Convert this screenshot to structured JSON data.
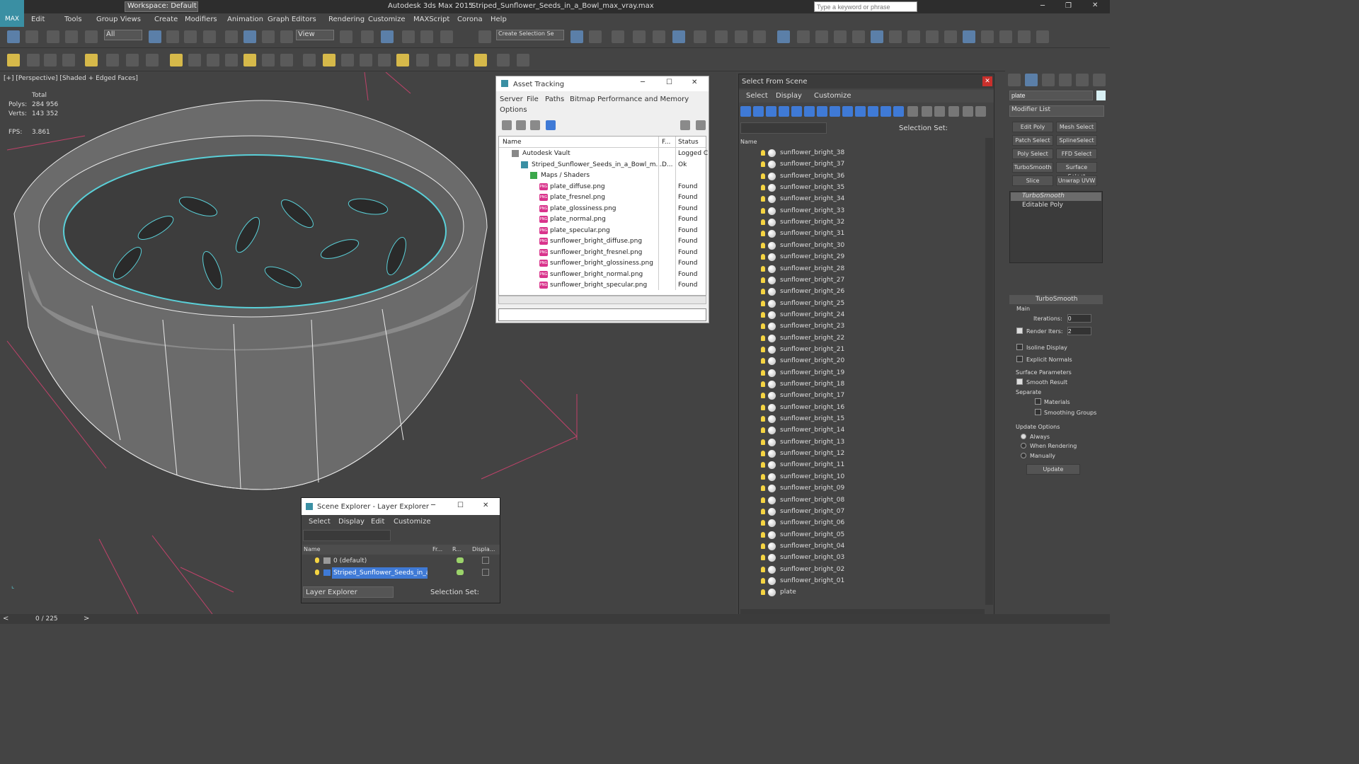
{
  "app": {
    "title": "Autodesk 3ds Max  2015",
    "file": "Striped_Sunflower_Seeds_in_a_Bowl_max_vray.max",
    "workspace": "Workspace: Default",
    "search_placeholder": "Type a keyword or phrase"
  },
  "menu": [
    "Edit",
    "Tools",
    "Group",
    "Views",
    "Create",
    "Modifiers",
    "Animation",
    "Graph Editors",
    "Rendering",
    "Customize",
    "MAXScript",
    "Corona",
    "Help"
  ],
  "toolbar": {
    "filter_all": "All",
    "view_select": "View",
    "create_selection": "Create Selection Se"
  },
  "viewport": {
    "label": "[+] [Perspective] [Shaded + Edged Faces]",
    "stats": {
      "total_label": "Total",
      "polys_label": "Polys:",
      "polys": "284 956",
      "verts_label": "Verts:",
      "verts": "143 352",
      "fps_label": "FPS:",
      "fps": "3.861"
    }
  },
  "asset_tracking": {
    "title": "Asset Tracking",
    "menu": [
      "Server",
      "File",
      "Paths",
      "Bitmap Performance and Memory"
    ],
    "options": "Options",
    "col_name": "Name",
    "col_f": "F...",
    "col_status": "Status",
    "rows": [
      {
        "name": "Autodesk Vault",
        "f": "",
        "status": "Logged C",
        "level": 0,
        "kind": "vault"
      },
      {
        "name": "Striped_Sunflower_Seeds_in_a_Bowl_m...",
        "f": "D...",
        "status": "Ok",
        "level": 1,
        "kind": "max"
      },
      {
        "name": "Maps / Shaders",
        "f": "",
        "status": "",
        "level": 2,
        "kind": "folder"
      },
      {
        "name": "plate_diffuse.png",
        "f": "",
        "status": "Found",
        "level": 3,
        "kind": "png"
      },
      {
        "name": "plate_fresnel.png",
        "f": "",
        "status": "Found",
        "level": 3,
        "kind": "png"
      },
      {
        "name": "plate_glossiness.png",
        "f": "",
        "status": "Found",
        "level": 3,
        "kind": "png"
      },
      {
        "name": "plate_normal.png",
        "f": "",
        "status": "Found",
        "level": 3,
        "kind": "png"
      },
      {
        "name": "plate_specular.png",
        "f": "",
        "status": "Found",
        "level": 3,
        "kind": "png"
      },
      {
        "name": "sunflower_bright_diffuse.png",
        "f": "",
        "status": "Found",
        "level": 3,
        "kind": "png"
      },
      {
        "name": "sunflower_bright_fresnel.png",
        "f": "",
        "status": "Found",
        "level": 3,
        "kind": "png"
      },
      {
        "name": "sunflower_bright_glossiness.png",
        "f": "",
        "status": "Found",
        "level": 3,
        "kind": "png"
      },
      {
        "name": "sunflower_bright_normal.png",
        "f": "",
        "status": "Found",
        "level": 3,
        "kind": "png"
      },
      {
        "name": "sunflower_bright_specular.png",
        "f": "",
        "status": "Found",
        "level": 3,
        "kind": "png"
      }
    ]
  },
  "select_from_scene": {
    "title": "Select From Scene",
    "menu": [
      "Select",
      "Display",
      "Customize"
    ],
    "selection_set": "Selection Set:",
    "col_name": "Name",
    "items": [
      "sunflower_bright_38",
      "sunflower_bright_37",
      "sunflower_bright_36",
      "sunflower_bright_35",
      "sunflower_bright_34",
      "sunflower_bright_33",
      "sunflower_bright_32",
      "sunflower_bright_31",
      "sunflower_bright_30",
      "sunflower_bright_29",
      "sunflower_bright_28",
      "sunflower_bright_27",
      "sunflower_bright_26",
      "sunflower_bright_25",
      "sunflower_bright_24",
      "sunflower_bright_23",
      "sunflower_bright_22",
      "sunflower_bright_21",
      "sunflower_bright_20",
      "sunflower_bright_19",
      "sunflower_bright_18",
      "sunflower_bright_17",
      "sunflower_bright_16",
      "sunflower_bright_15",
      "sunflower_bright_14",
      "sunflower_bright_13",
      "sunflower_bright_12",
      "sunflower_bright_11",
      "sunflower_bright_10",
      "sunflower_bright_09",
      "sunflower_bright_08",
      "sunflower_bright_07",
      "sunflower_bright_06",
      "sunflower_bright_05",
      "sunflower_bright_04",
      "sunflower_bright_03",
      "sunflower_bright_02",
      "sunflower_bright_01",
      "plate"
    ]
  },
  "scene_explorer": {
    "title": "Scene Explorer - Layer Explorer",
    "menu": [
      "Select",
      "Display",
      "Edit",
      "Customize"
    ],
    "col_name": "Name",
    "col_fr": "Fr...",
    "col_r": "R...",
    "col_disp": "Displa...",
    "rows": [
      {
        "name": "0 (default)",
        "selected": false
      },
      {
        "name": "Striped_Sunflower_Seeds_in_a...",
        "selected": true
      }
    ],
    "explorer_select": "Layer Explorer",
    "selection_set": "Selection Set:"
  },
  "command_panel": {
    "object_name": "plate",
    "modifier_list": "Modifier List",
    "buttons": [
      "Edit Poly",
      "Mesh Select",
      "Patch Select",
      "SplineSelect",
      "Poly Select",
      "FFD Select",
      "TurboSmooth",
      "Surface Select",
      "Slice",
      "Unwrap UVW"
    ],
    "stack": [
      "TurboSmooth",
      "Editable Poly"
    ],
    "rollout": "TurboSmooth",
    "main": "Main",
    "iterations_label": "Iterations:",
    "iterations": "0",
    "render_iters_label": "Render Iters:",
    "render_iters": "2",
    "isoline": "Isoline Display",
    "explicit": "Explicit Normals",
    "surface_params": "Surface Parameters",
    "smooth_result": "Smooth Result",
    "separate": "Separate",
    "materials": "Materials",
    "smoothing_groups": "Smoothing Groups",
    "update_options": "Update Options",
    "always": "Always",
    "when_rendering": "When Rendering",
    "manually": "Manually",
    "update": "Update"
  },
  "status": {
    "frames": "0 / 225"
  },
  "colors": {
    "accent": "#5ad0d8",
    "ui_dark": "#444444",
    "select_blue": "#3f7ad6",
    "png_icon": "#d9348c"
  }
}
